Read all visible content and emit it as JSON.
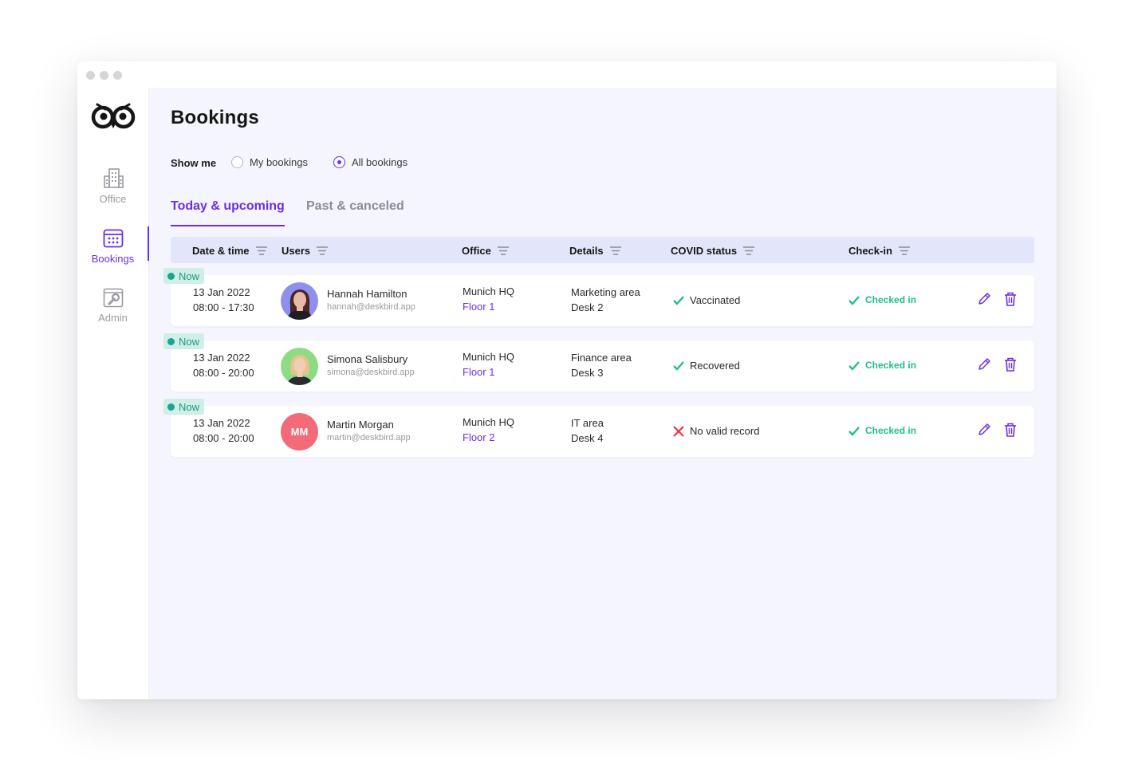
{
  "page": {
    "title": "Bookings"
  },
  "brand": {
    "accent": "#6d2ee8",
    "green": "#1fbf88",
    "red": "#ee3344",
    "teal_badge": "#cfeee6"
  },
  "sidebar": {
    "items": [
      {
        "label": "Office",
        "icon": "office-building-icon",
        "active": false
      },
      {
        "label": "Bookings",
        "icon": "calendar-icon",
        "active": true
      },
      {
        "label": "Admin",
        "icon": "admin-wrench-icon",
        "active": false
      }
    ]
  },
  "filter": {
    "label": "Show me",
    "options": [
      {
        "label": "My bookings",
        "checked": false
      },
      {
        "label": "All bookings",
        "checked": true
      }
    ]
  },
  "tabs": [
    {
      "label": "Today & upcoming",
      "active": true
    },
    {
      "label": "Past & canceled",
      "active": false
    }
  ],
  "table": {
    "columns": [
      "Date & time",
      "Users",
      "Office",
      "Details",
      "COVID status",
      "Check-in"
    ],
    "rows": [
      {
        "badge": "Now",
        "date": "13 Jan 2022",
        "time": "08:00 - 17:30",
        "user_name": "Hannah Hamilton",
        "user_email": "hannah@deskbird.app",
        "avatar": "photo",
        "avatar_bg": "#8e90f0",
        "office": "Munich HQ",
        "floor": "Floor 1",
        "area": "Marketing area",
        "desk": "Desk 2",
        "covid": "Vaccinated",
        "covid_ok": true,
        "checkin": "Checked in"
      },
      {
        "badge": "Now",
        "date": "13 Jan 2022",
        "time": "08:00 - 20:00",
        "user_name": "Simona Salisbury",
        "user_email": "simona@deskbird.app",
        "avatar": "photo",
        "avatar_bg": "#8edb86",
        "office": "Munich HQ",
        "floor": "Floor 1",
        "area": "Finance area",
        "desk": "Desk 3",
        "covid": "Recovered",
        "covid_ok": true,
        "checkin": "Checked in"
      },
      {
        "badge": "Now",
        "date": "13 Jan 2022",
        "time": "08:00 - 20:00",
        "user_name": "Martin Morgan",
        "user_email": "martin@deskbird.app",
        "avatar": "initials",
        "initials": "MM",
        "avatar_bg": "#f36a79",
        "office": "Munich HQ",
        "floor": "Floor 2",
        "area": "IT area",
        "desk": "Desk 4",
        "covid": "No valid record",
        "covid_ok": false,
        "checkin": "Checked in"
      }
    ]
  }
}
